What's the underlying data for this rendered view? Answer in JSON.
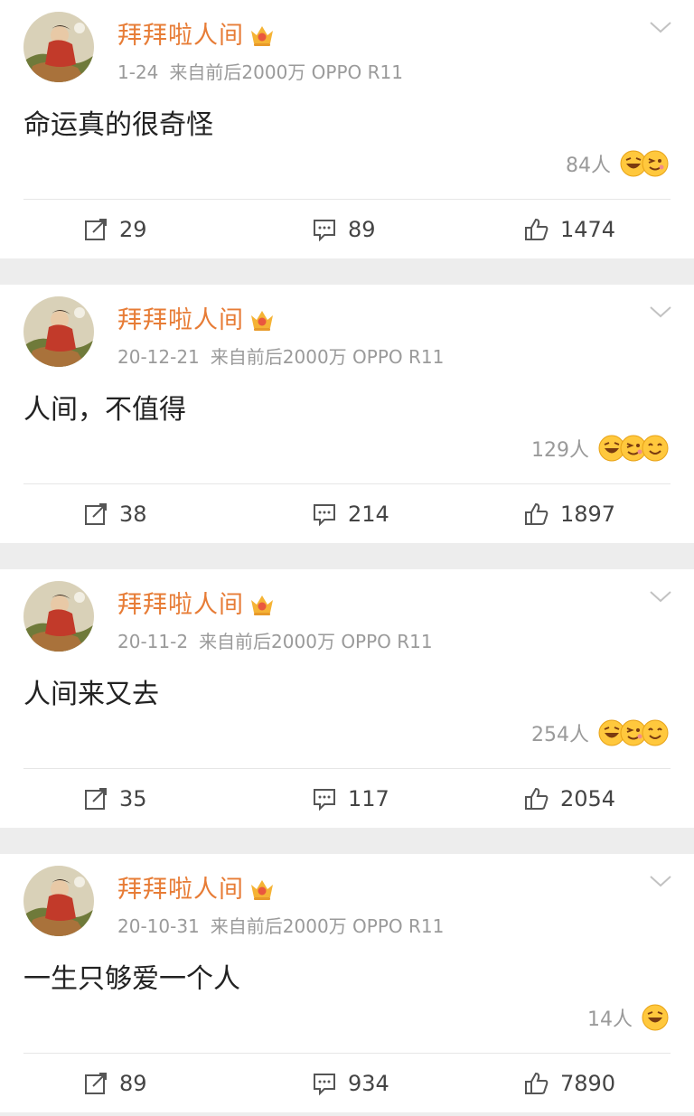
{
  "colors": {
    "username": "#e77c36",
    "meta": "#9a9a9a",
    "background": "#ededed",
    "card": "#ffffff"
  },
  "posts": [
    {
      "username": "拜拜啦人间",
      "date": "1-24",
      "source": "来自前后2000万 OPPO R11",
      "content": "命运真的很奇怪",
      "reaction_count": "84人",
      "reaction_icons": [
        "laugh-emoji",
        "wink-emoji"
      ],
      "reposts": "29",
      "comments": "89",
      "likes": "1474"
    },
    {
      "username": "拜拜啦人间",
      "date": "20-12-21",
      "source": "来自前后2000万 OPPO R11",
      "content": "人间，不值得",
      "reaction_count": "129人",
      "reaction_icons": [
        "laugh-emoji",
        "wink-emoji",
        "smile-emoji"
      ],
      "reposts": "38",
      "comments": "214",
      "likes": "1897"
    },
    {
      "username": "拜拜啦人间",
      "date": "20-11-2",
      "source": "来自前后2000万 OPPO R11",
      "content": "人间来又去",
      "reaction_count": "254人",
      "reaction_icons": [
        "laugh-emoji",
        "wink-emoji",
        "smile-emoji"
      ],
      "reposts": "35",
      "comments": "117",
      "likes": "2054"
    },
    {
      "username": "拜拜啦人间",
      "date": "20-10-31",
      "source": "来自前后2000万 OPPO R11",
      "content": "一生只够爱一个人",
      "reaction_count": "14人",
      "reaction_icons": [
        "laugh-emoji"
      ],
      "reposts": "89",
      "comments": "934",
      "likes": "7890"
    }
  ]
}
